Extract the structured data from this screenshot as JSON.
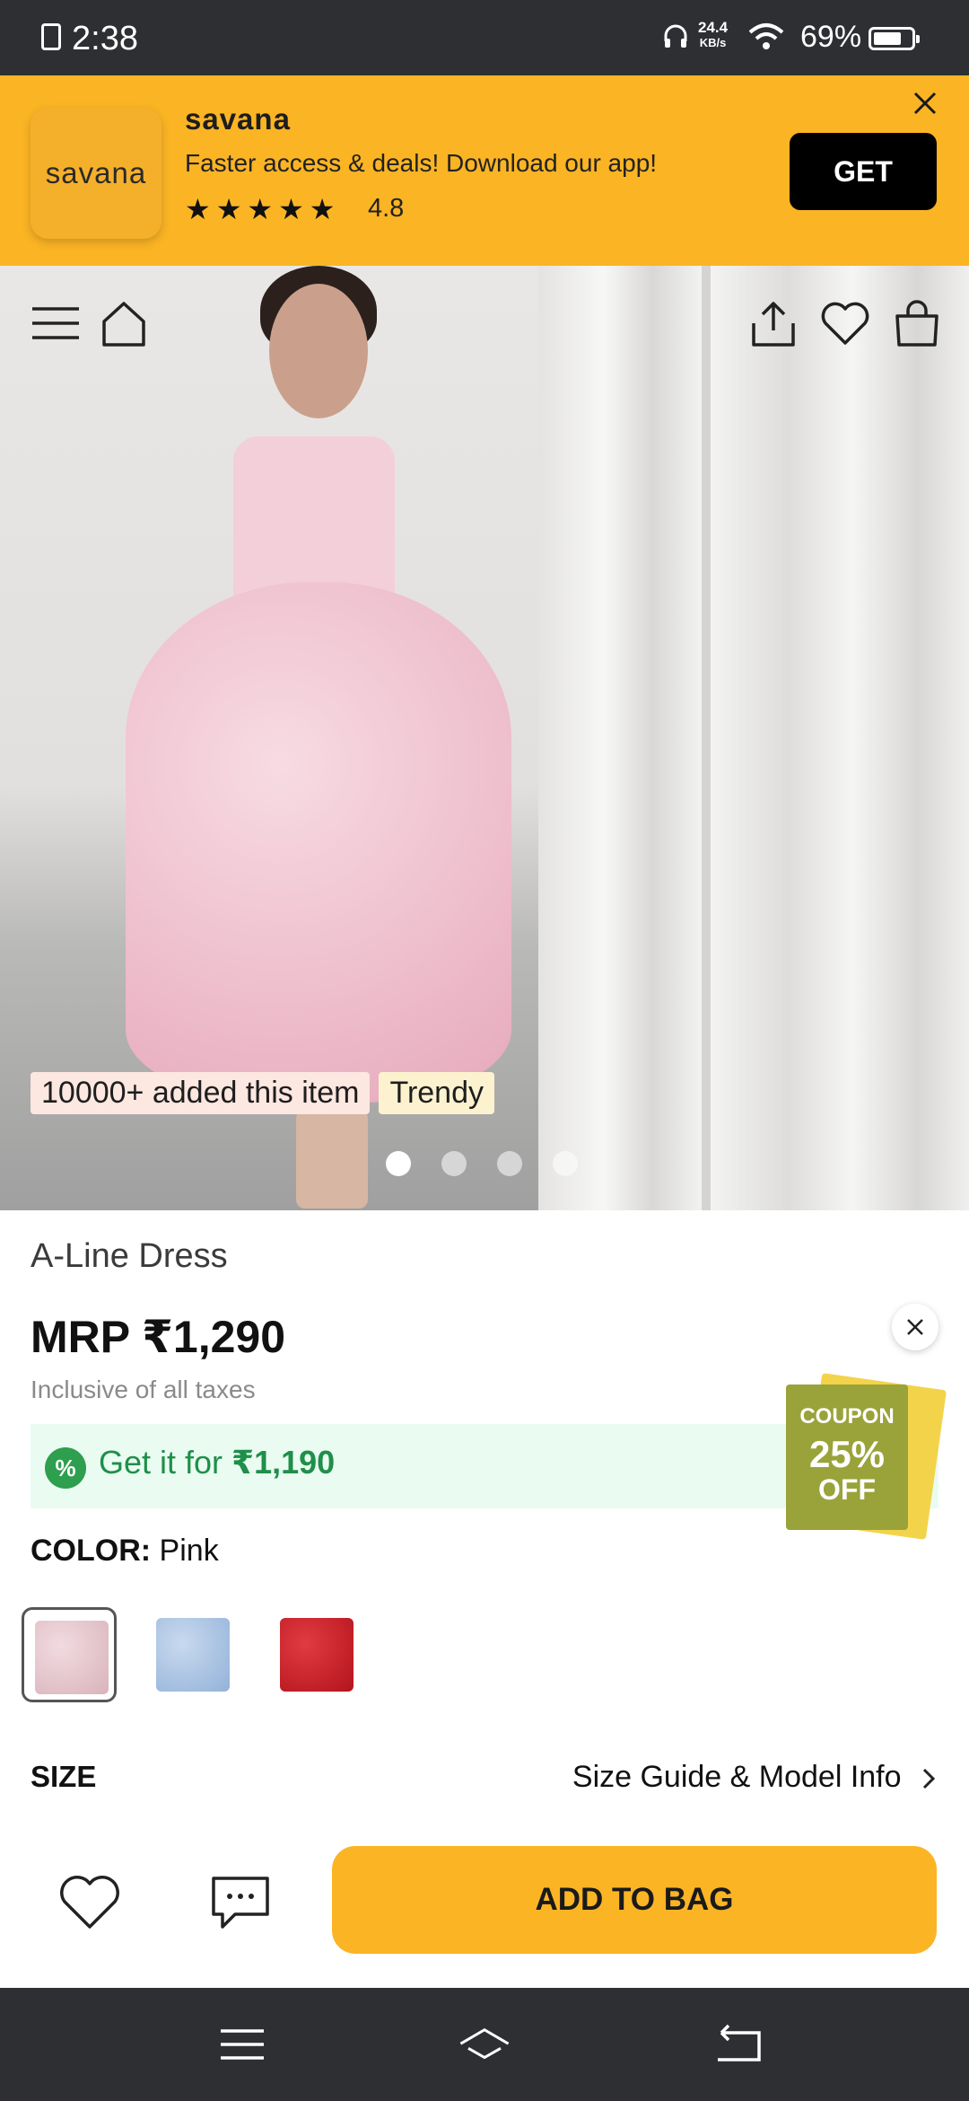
{
  "status_bar": {
    "time": "2:38",
    "net_speed_value": "24.4",
    "net_speed_unit": "KB/s",
    "battery": "69%"
  },
  "app_banner": {
    "logo_text": "savana",
    "app_name": "savana",
    "tagline": "Faster access & deals! Download our app!",
    "stars": "★★★★★",
    "rating": "4.8",
    "get_label": "GET"
  },
  "gallery": {
    "tags": [
      "10000+ added this item",
      "Trendy"
    ],
    "dot_count": 4,
    "active_dot": 0
  },
  "product": {
    "title": "A-Line Dress",
    "price": "MRP ₹1,290",
    "tax_note": "Inclusive of all taxes",
    "offer_prefix": "Get it for ",
    "offer_price": "₹1,190",
    "offer_icon": "%",
    "coupon_line1": "COUPON",
    "coupon_line2": "25%",
    "coupon_line3": "OFF",
    "color_label": "COLOR:",
    "color_value": "Pink",
    "swatches": [
      {
        "color": "#e8c7cf",
        "selected": true
      },
      {
        "color": "#a9c3e3",
        "selected": false
      },
      {
        "color": "#cc1f2a",
        "selected": false
      }
    ],
    "size_label": "SIZE",
    "size_guide": "Size Guide & Model Info"
  },
  "action_bar": {
    "add_to_bag": "ADD TO BAG"
  },
  "colors": {
    "brand_yellow": "#fbb424",
    "offer_green": "#1f8f4a",
    "offer_bg": "#eafcf1"
  }
}
